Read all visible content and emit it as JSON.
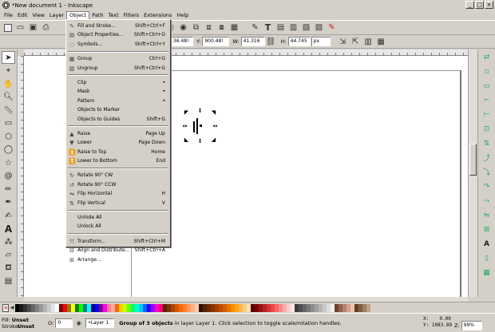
{
  "window": {
    "title": "*New document 1 - Inkscape",
    "controls": [
      "_",
      "□",
      "×"
    ]
  },
  "menubar": [
    "File",
    "Edit",
    "View",
    "Layer",
    "Object",
    "Path",
    "Text",
    "Filters",
    "Extensions",
    "Help"
  ],
  "menubar_active": "Object",
  "controls": {
    "x_value": "36.48!",
    "y_label": "Y:",
    "y_value": "900.48!",
    "w_label": "W:",
    "w_value": "41.316",
    "h_label": "H:",
    "h_value": "44.745",
    "unit": "px"
  },
  "object_menu": {
    "group1": [
      {
        "label": "Fill and Stroke...",
        "shortcut": "Shift+Ctrl+F",
        "icon": "fill-stroke-icon"
      },
      {
        "label": "Object Properties...",
        "shortcut": "Shift+Ctrl+O",
        "icon": "properties-icon"
      },
      {
        "label": "Symbols...",
        "shortcut": "Shift+Ctrl+Y",
        "icon": "symbols-icon"
      }
    ],
    "group2": [
      {
        "label": "Group",
        "shortcut": "Ctrl+G",
        "icon": "group-icon"
      },
      {
        "label": "Ungroup",
        "shortcut": "Shift+Ctrl+G",
        "icon": "ungroup-icon"
      }
    ],
    "group3": [
      {
        "label": "Clip",
        "shortcut": "▸",
        "icon": ""
      },
      {
        "label": "Mask",
        "shortcut": "▸",
        "icon": ""
      },
      {
        "label": "Pattern",
        "shortcut": "▸",
        "icon": ""
      },
      {
        "label": "Objects to Marker",
        "shortcut": "",
        "icon": ""
      },
      {
        "label": "Objects to Guides",
        "shortcut": "Shift+G",
        "icon": ""
      }
    ],
    "group4": [
      {
        "label": "Raise",
        "shortcut": "Page Up",
        "icon": "raise-icon"
      },
      {
        "label": "Lower",
        "shortcut": "Page Down",
        "icon": "lower-icon"
      },
      {
        "label": "Raise to Top",
        "shortcut": "Home",
        "icon": "raise-top-icon"
      },
      {
        "label": "Lower to Bottom",
        "shortcut": "End",
        "icon": "lower-bottom-icon"
      }
    ],
    "group5": [
      {
        "label": "Rotate 90° CW",
        "shortcut": "",
        "icon": "rotate-cw-icon"
      },
      {
        "label": "Rotate 90° CCW",
        "shortcut": "",
        "icon": "rotate-ccw-icon"
      },
      {
        "label": "Flip Horizontal",
        "shortcut": "H",
        "icon": "flip-h-icon"
      },
      {
        "label": "Flip Vertical",
        "shortcut": "V",
        "icon": "flip-v-icon"
      }
    ],
    "group6": [
      {
        "label": "Unhide All",
        "shortcut": "",
        "icon": ""
      },
      {
        "label": "Unlock All",
        "shortcut": "",
        "icon": ""
      }
    ],
    "group7": [
      {
        "label": "Transform...",
        "shortcut": "Shift+Ctrl+M",
        "icon": "transform-icon"
      },
      {
        "label": "Align and Distribute...",
        "shortcut": "Shift+Ctrl+A",
        "icon": "align-icon"
      },
      {
        "label": "Arrange...",
        "shortcut": "",
        "icon": "arrange-icon"
      }
    ]
  },
  "status": {
    "fill_label": "Fill:",
    "fill_value": "Unset",
    "stroke_label": "Stroke:",
    "stroke_value": "Unset",
    "opacity_label": "O:",
    "opacity_value": "0",
    "layer": "•Layer 1",
    "message": "Group of 3 objects in layer Layer 1. Click selection to toggle scale/rotation handles.",
    "x_label": "X:",
    "x_value": "0.00",
    "y_label": "Y:",
    "y_value": "1083.89",
    "z_label": "Z:",
    "zoom": "99%"
  },
  "palette": [
    "#000000",
    "#1a1a1a",
    "#333333",
    "#4d4d4d",
    "#666666",
    "#808080",
    "#999999",
    "#b3b3b3",
    "#cccccc",
    "#e6e6e6",
    "#ffffff",
    "#800000",
    "#ff0000",
    "#808000",
    "#ffff00",
    "#008000",
    "#00ff00",
    "#008080",
    "#00ffff",
    "#000080",
    "#0000ff",
    "#800080",
    "#ff00ff",
    "#ff8080",
    "#ffaaaa",
    "#ff6600",
    "#ffcc00",
    "#ccff00",
    "#66ff00",
    "#00ff66",
    "#00ffcc",
    "#00ccff",
    "#0066ff",
    "#3300ff",
    "#9900ff",
    "#ff00cc",
    "#ff0066",
    "#552200",
    "#803300",
    "#aa4400",
    "#d45500",
    "#ff6600",
    "#ff7f2a",
    "#ff9955",
    "#ffb380",
    "#ffccaa",
    "#2b1100",
    "#552200",
    "#6c2b00",
    "#8a3600",
    "#a44000",
    "#c04c00",
    "#d35f00",
    "#e87400",
    "#ff8c00",
    "#ffa319",
    "#ffb84d",
    "#ffcc80",
    "#ffe0b3",
    "#5a0000",
    "#7f0000",
    "#9b1111",
    "#b82222",
    "#d43333",
    "#ee4545",
    "#f76666",
    "#fb8888",
    "#fcaaaa",
    "#fdcccc",
    "#fee5e5",
    "#3c3c3c",
    "#505050",
    "#646464",
    "#787878",
    "#8c8c8c",
    "#a0a0a0",
    "#b4b4b4",
    "#c8c8c8",
    "#dcdcdc",
    "#f0f0f0",
    "#704030",
    "#906050",
    "#b08070",
    "#d0a090",
    "#f0c0b0",
    "#604020",
    "#806040",
    "#a08060",
    "#c0a080"
  ]
}
